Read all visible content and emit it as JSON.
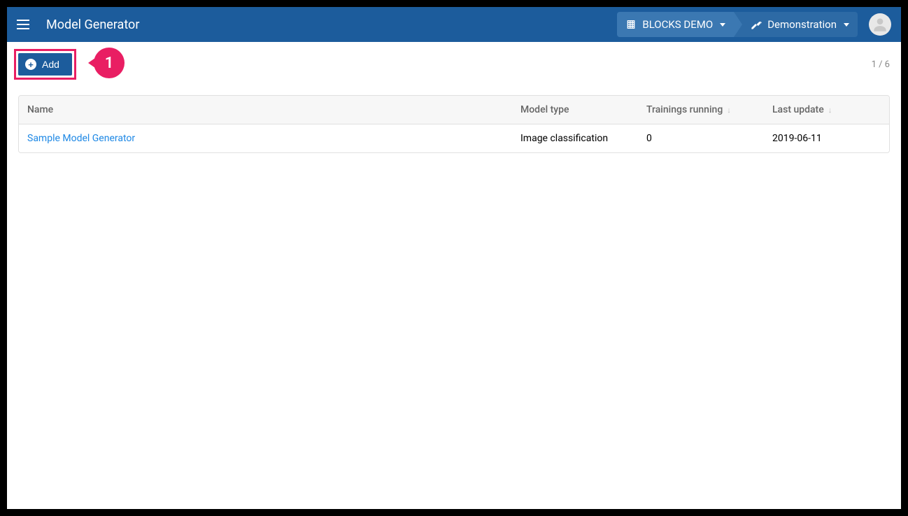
{
  "header": {
    "title": "Model Generator",
    "breadcrumb1": "BLOCKS DEMO",
    "breadcrumb2": "Demonstration"
  },
  "toolbar": {
    "add_label": "Add",
    "pager": "1 / 6"
  },
  "callout": {
    "number": "1"
  },
  "table": {
    "headers": {
      "name": "Name",
      "model_type": "Model type",
      "trainings_running": "Trainings running",
      "last_update": "Last update"
    },
    "rows": [
      {
        "name": "Sample Model Generator",
        "model_type": "Image classification",
        "trainings_running": "0",
        "last_update": "2019-06-11"
      }
    ]
  }
}
